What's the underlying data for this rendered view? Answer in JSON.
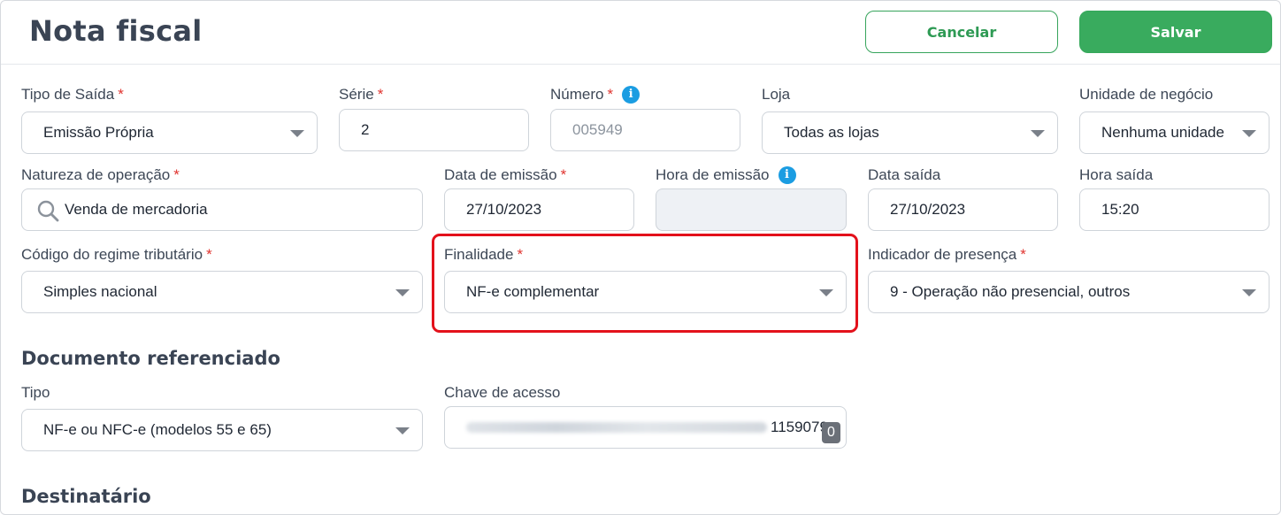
{
  "header": {
    "title": "Nota fiscal",
    "cancel_label": "Cancelar",
    "save_label": "Salvar"
  },
  "form": {
    "tipo_saida": {
      "label": "Tipo de Saída",
      "required": "*",
      "value": "Emissão Própria"
    },
    "serie": {
      "label": "Série",
      "required": "*",
      "value": "2"
    },
    "numero": {
      "label": "Número",
      "required": "*",
      "value": "005949"
    },
    "loja": {
      "label": "Loja",
      "value": "Todas as lojas"
    },
    "unidade": {
      "label": "Unidade de negócio",
      "value": "Nenhuma unidade"
    },
    "natureza": {
      "label": "Natureza de operação",
      "required": "*",
      "value": "Venda de mercadoria"
    },
    "data_emissao": {
      "label": "Data de emissão",
      "required": "*",
      "value": "27/10/2023"
    },
    "hora_emissao": {
      "label": "Hora de emissão",
      "value": ""
    },
    "data_saida": {
      "label": "Data saída",
      "value": "27/10/2023"
    },
    "hora_saida": {
      "label": "Hora saída",
      "value": "15:20"
    },
    "regime": {
      "label": "Código do regime tributário",
      "required": "*",
      "value": "Simples nacional"
    },
    "finalidade": {
      "label": "Finalidade",
      "required": "*",
      "value": "NF-e complementar"
    },
    "presenca": {
      "label": "Indicador de presença",
      "required": "*",
      "value": "9 - Operação não presencial, outros"
    }
  },
  "documento": {
    "title": "Documento referenciado",
    "tipo": {
      "label": "Tipo",
      "value": "NF-e ou NFC-e (modelos 55 e 65)"
    },
    "chave": {
      "label": "Chave de acesso",
      "visible_suffix": "1159079",
      "badge": "0"
    }
  },
  "destinatario": {
    "title": "Destinatário"
  },
  "info_icon_glyph": "i",
  "colors": {
    "accent_green": "#39ab5e",
    "required_red": "#e0342f",
    "info_blue": "#1b9de2",
    "highlight_red": "#e3111b"
  }
}
